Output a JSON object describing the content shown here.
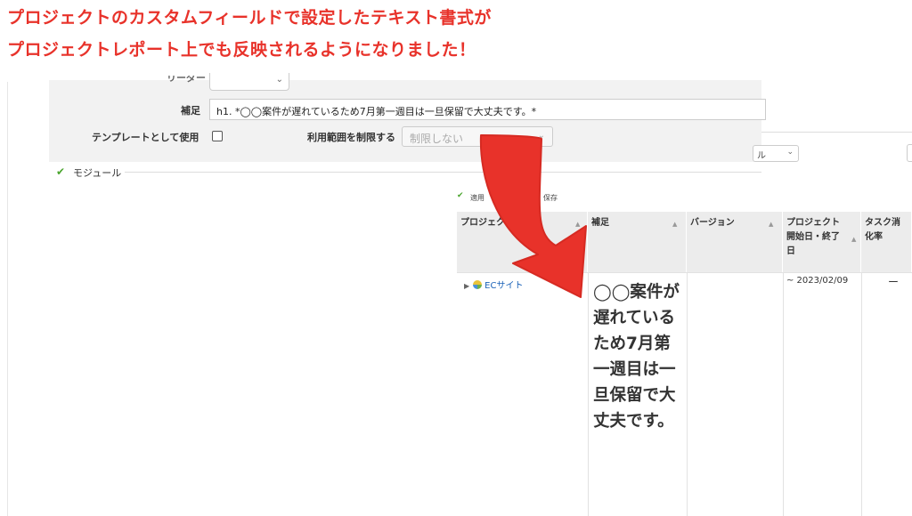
{
  "headline": {
    "line1": "プロジェクトのカスタムフィールドで設定したテキスト書式が",
    "line2": "プロジェクトレポート上でも反映されるようになりました！"
  },
  "form": {
    "leader_label": "リーダー",
    "note_label": "補足",
    "note_value": "h1. *◯◯案件が遅れているため7月第一週目は一旦保留で大丈夫です。*",
    "template_label": "テンプレートとして使用",
    "limit_label": "利用範囲を制限する",
    "limit_value": "制限しない",
    "right_select_value": "ル"
  },
  "module": {
    "label": "モジュール"
  },
  "toolbar": {
    "apply": "適用",
    "clear": "クリア",
    "save": "保存"
  },
  "table": {
    "headers": {
      "project": "プロジェクト",
      "note": "補足",
      "version": "バージョン",
      "dates_l1": "プロジェクト",
      "dates_l2": "開始日・終了",
      "dates_l3": "日",
      "task_l1": "タスク消",
      "task_l2": "化率"
    },
    "row": {
      "project": "ECサイト",
      "note": "◯◯案件が遅れているため7月第一週目は一旦保留で大丈夫です。",
      "version": "",
      "dates": "~ 2023/02/09",
      "task_rate": "ー"
    }
  },
  "colors": {
    "accent_red": "#e8322a",
    "link_blue": "#1a62b8",
    "check_green": "#4aa52e"
  }
}
